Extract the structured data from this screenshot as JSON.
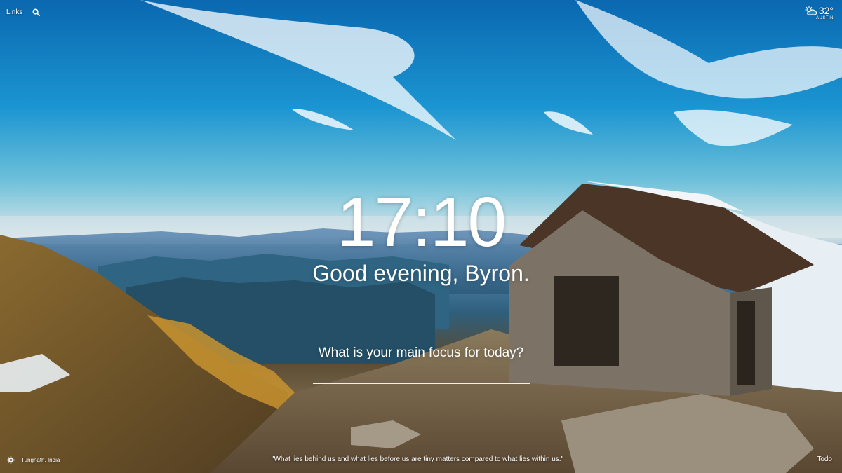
{
  "top_left": {
    "links_label": "Links",
    "search_icon": "search-icon"
  },
  "weather": {
    "icon": "partly-cloudy-icon",
    "temperature": "32°",
    "location": "AUSTIN"
  },
  "center": {
    "time": "17:10",
    "greeting": "Good evening, Byron.",
    "focus_prompt": "What is your main focus for today?",
    "focus_value": ""
  },
  "bottom": {
    "settings_icon": "gear-icon",
    "photo_location": "Tungnath, India",
    "quote": "\"What lies behind us and what lies before us are tiny matters compared to what lies within us.\"",
    "todo_label": "Todo"
  }
}
